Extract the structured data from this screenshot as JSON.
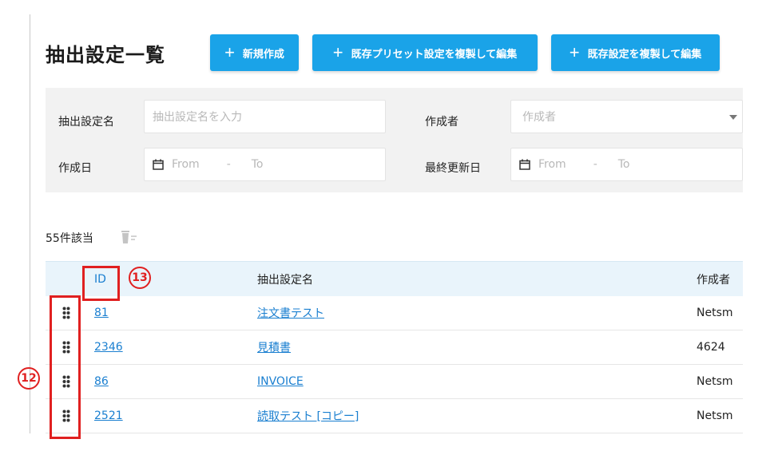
{
  "header": {
    "title": "抽出設定一覧",
    "buttons": {
      "new": "新規作成",
      "preset_copy": "既存プリセット設定を複製して編集",
      "existing_copy": "既存設定を複製して編集"
    }
  },
  "filters": {
    "name_label": "抽出設定名",
    "name_placeholder": "抽出設定名を入力",
    "creator_label": "作成者",
    "creator_placeholder": "作成者",
    "created_label": "作成日",
    "updated_label": "最終更新日",
    "from": "From",
    "dash": "-",
    "to": "To"
  },
  "results": {
    "count_text": "55件該当"
  },
  "table": {
    "columns": [
      "ID",
      "抽出設定名",
      "作成者"
    ],
    "rows": [
      {
        "id": "81",
        "name": "注文書テスト",
        "creator": "Netsm"
      },
      {
        "id": "2346",
        "name": "見積書",
        "creator": "4624"
      },
      {
        "id": "86",
        "name": "INVOICE",
        "creator": "Netsm"
      },
      {
        "id": "2521",
        "name": "読取テスト [コピー]",
        "creator": "Netsm"
      }
    ]
  },
  "annotations": {
    "drag_marker": "12",
    "id_marker": "13"
  },
  "colors": {
    "accent": "#1aa3e8",
    "link": "#1a7fd0",
    "annotation": "#e02020",
    "panel_bg": "#f2f2f2",
    "header_bg": "#e9f4fb"
  }
}
